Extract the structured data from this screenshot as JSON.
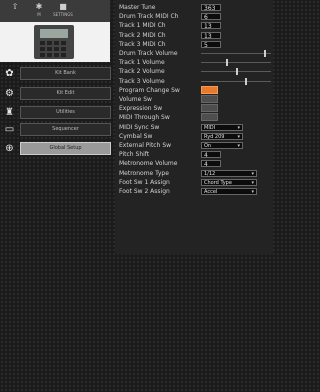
{
  "toolbar": {
    "items": [
      {
        "icon": "⇧",
        "label": "",
        "icon_name": "upload-icon"
      },
      {
        "icon": "✱",
        "label": "M",
        "icon_name": "menu-icon"
      },
      {
        "icon": "■",
        "label": "SETTINGS",
        "icon_name": "settings-icon"
      }
    ]
  },
  "sidebar": {
    "items": [
      {
        "label": "Kit Bank",
        "icon": "drum-kit-icon",
        "glyph": "✿",
        "active": false
      },
      {
        "label": "Kit Edit",
        "icon": "drum-edit-icon",
        "glyph": "⚙",
        "active": false
      },
      {
        "label": "Utilities",
        "icon": "utilities-icon",
        "glyph": "♜",
        "active": false
      },
      {
        "label": "Sequencer",
        "icon": "sequencer-icon",
        "glyph": "▭",
        "active": false
      },
      {
        "label": "Global Setup",
        "icon": "globe-icon",
        "glyph": "⊕",
        "active": true
      }
    ]
  },
  "settings": [
    {
      "label": "Master Tune",
      "type": "number",
      "value": "363"
    },
    {
      "label": "Drum Track MIDI Ch",
      "type": "number",
      "value": "6"
    },
    {
      "label": "Track 1 MIDI Ch",
      "type": "number",
      "value": "13"
    },
    {
      "label": "Track 2 MIDI Ch",
      "type": "number",
      "value": "13"
    },
    {
      "label": "Track 3 MIDI Ch",
      "type": "number",
      "value": "5"
    },
    {
      "label": "Drum Track Volume",
      "type": "slider",
      "level": 0.92
    },
    {
      "label": "Track 1 Volume",
      "type": "slider",
      "level": 0.37
    },
    {
      "label": "Track 2 Volume",
      "type": "slider",
      "level": 0.52
    },
    {
      "label": "Track 3 Volume",
      "type": "slider",
      "level": 0.64
    },
    {
      "label": "Program Change Sw",
      "type": "toggle",
      "on": true
    },
    {
      "label": "Volume Sw",
      "type": "toggle",
      "on": false
    },
    {
      "label": "Expression Sw",
      "type": "toggle",
      "on": false
    },
    {
      "label": "MIDI Through Sw",
      "type": "toggle",
      "on": false
    },
    {
      "label": "MIDI Sync Sw",
      "type": "select",
      "value": "MIDI",
      "width": "short"
    },
    {
      "label": "Cymbal Sw",
      "type": "select",
      "value": "Ryd 209",
      "width": "short"
    },
    {
      "label": "External Pitch Sw",
      "type": "select",
      "value": "On",
      "width": "short"
    },
    {
      "label": "Pitch Shift",
      "type": "number",
      "value": "4"
    },
    {
      "label": "Metronome Volume",
      "type": "number",
      "value": "4"
    },
    {
      "label": "Metronome Type",
      "type": "select",
      "value": "1/12",
      "width": "long"
    },
    {
      "label": "Foot Sw 1 Assign",
      "type": "select",
      "value": "Chord Type",
      "width": "long"
    },
    {
      "label": "Foot Sw 2 Assign",
      "type": "select",
      "value": "Accel",
      "width": "long"
    }
  ],
  "colors": {
    "accent_on": "#e8792e",
    "panel_bg": "#232323",
    "sidebar_bg": "#1b1b1b"
  }
}
